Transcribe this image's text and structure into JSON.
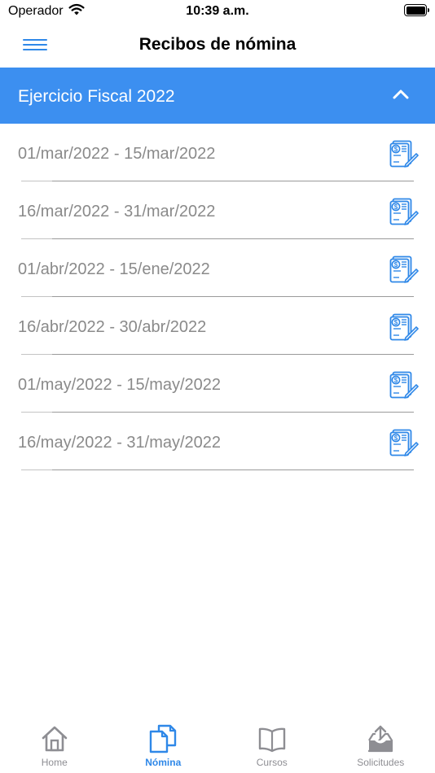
{
  "status_bar": {
    "carrier": "Operador",
    "time": "10:39 a.m."
  },
  "nav": {
    "title": "Recibos de nómina",
    "menu_icon": "hamburger-menu-icon"
  },
  "section": {
    "title": "Ejercicio Fiscal 2022",
    "expanded": true,
    "icon": "chevron-up-icon"
  },
  "receipts": [
    {
      "label": "01/mar/2022 - 15/mar/2022",
      "icon": "payroll-receipt-icon"
    },
    {
      "label": "16/mar/2022 - 31/mar/2022",
      "icon": "payroll-receipt-icon"
    },
    {
      "label": "01/abr/2022 - 15/ene/2022",
      "icon": "payroll-receipt-icon"
    },
    {
      "label": "16/abr/2022 - 30/abr/2022",
      "icon": "payroll-receipt-icon"
    },
    {
      "label": "01/may/2022 - 15/may/2022",
      "icon": "payroll-receipt-icon"
    },
    {
      "label": "16/may/2022 - 31/may/2022",
      "icon": "payroll-receipt-icon"
    }
  ],
  "tabs": [
    {
      "label": "Home",
      "icon": "home-icon",
      "active": false
    },
    {
      "label": "Nómina",
      "icon": "documents-icon",
      "active": true
    },
    {
      "label": "Cursos",
      "icon": "book-icon",
      "active": false
    },
    {
      "label": "Solicitudes",
      "icon": "upload-tray-icon",
      "active": false
    }
  ],
  "colors": {
    "accent": "#3c8ff0",
    "tab_active": "#2f88e8",
    "tab_inactive": "#8e8e93",
    "row_text": "#8a8a8a"
  }
}
